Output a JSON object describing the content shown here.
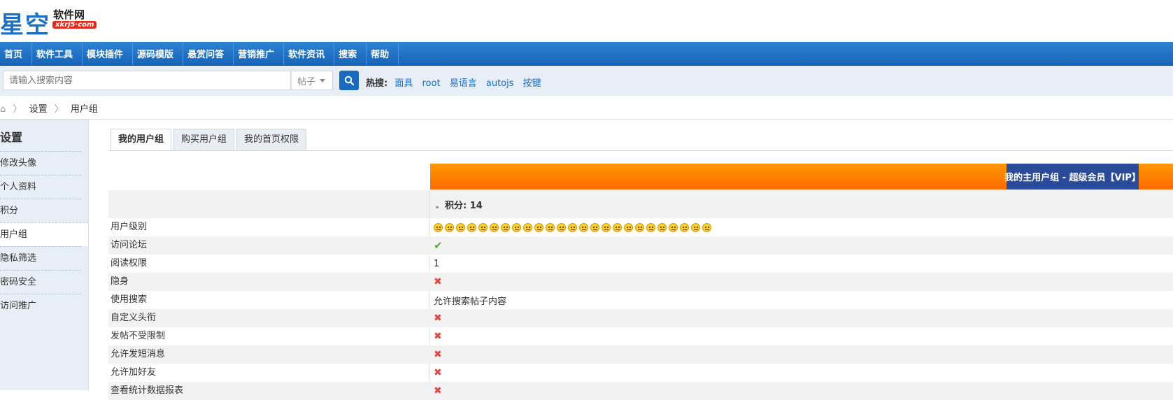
{
  "logo": {
    "big": "星空",
    "small": "软件网",
    "url": "xkrj5·com"
  },
  "nav": [
    "首页",
    "软件工具",
    "模块插件",
    "源码模版",
    "悬赏问答",
    "营销推广",
    "软件资讯",
    "搜索",
    "帮助"
  ],
  "search": {
    "placeholder": "请输入搜索内容",
    "type": "帖子",
    "hot_label": "热搜:",
    "hot_keywords": [
      "面具",
      "root",
      "易语言",
      "autojs",
      "按键"
    ]
  },
  "breadcrumb": {
    "home_icon": "home-icon",
    "items": [
      "设置",
      "用户组"
    ]
  },
  "sidebar": {
    "title": "设置",
    "items": [
      "修改头像",
      "个人资料",
      "积分",
      "用户组",
      "隐私筛选",
      "密码安全",
      "访问推广"
    ],
    "active": "用户组"
  },
  "tabs": [
    "我的用户组",
    "购买用户组",
    "我的首页权限"
  ],
  "group": {
    "title": "我的主用户组 - 超级会员【VIP】",
    "score": "积分: 14",
    "level_icons": 25
  },
  "rows": [
    {
      "label": "用户级别",
      "type": "faces"
    },
    {
      "label": "访问论坛",
      "type": "check"
    },
    {
      "label": "阅读权限",
      "type": "text",
      "value": "1"
    },
    {
      "label": "隐身",
      "type": "cross"
    },
    {
      "label": "使用搜索",
      "type": "text",
      "value": "允许搜索帖子内容"
    },
    {
      "label": "自定义头衔",
      "type": "cross"
    },
    {
      "label": "发帖不受限制",
      "type": "cross"
    },
    {
      "label": "允许发短消息",
      "type": "cross"
    },
    {
      "label": "允许加好友",
      "type": "cross"
    },
    {
      "label": "查看统计数据报表",
      "type": "cross"
    }
  ],
  "colors": {
    "nav": "#1d6fc0",
    "orange": "#ff7b00",
    "vip": "#2a4a9a",
    "link": "#1a6bbd"
  }
}
